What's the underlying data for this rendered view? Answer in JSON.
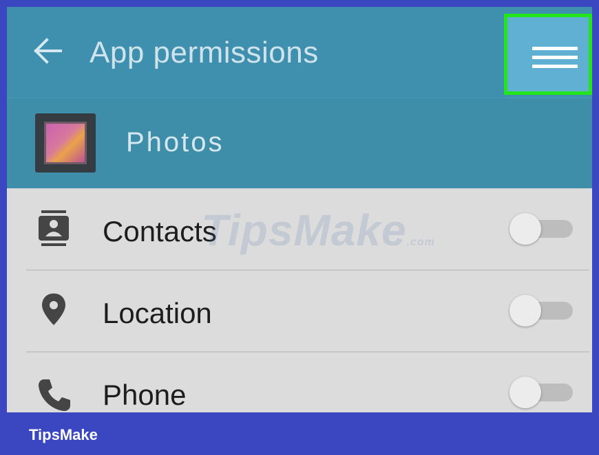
{
  "header": {
    "title": "App permissions",
    "back_icon": "arrow-left-icon",
    "menu_icon": "hamburger-menu-icon",
    "highlight_color": "#22e51a"
  },
  "app": {
    "name": "Photos",
    "icon": "photos-app-icon"
  },
  "permissions": [
    {
      "label": "Contacts",
      "icon": "contacts-icon",
      "enabled": false
    },
    {
      "label": "Location",
      "icon": "location-pin-icon",
      "enabled": false
    },
    {
      "label": "Phone",
      "icon": "phone-icon",
      "enabled": false
    }
  ],
  "watermark": {
    "text": "TipsMake",
    "suffix": ".com"
  },
  "footer": {
    "brand": "TipsMake"
  },
  "colors": {
    "appbar": "#3f8fae",
    "list_bg": "#dcdcdc",
    "frame": "#3b47c0"
  }
}
